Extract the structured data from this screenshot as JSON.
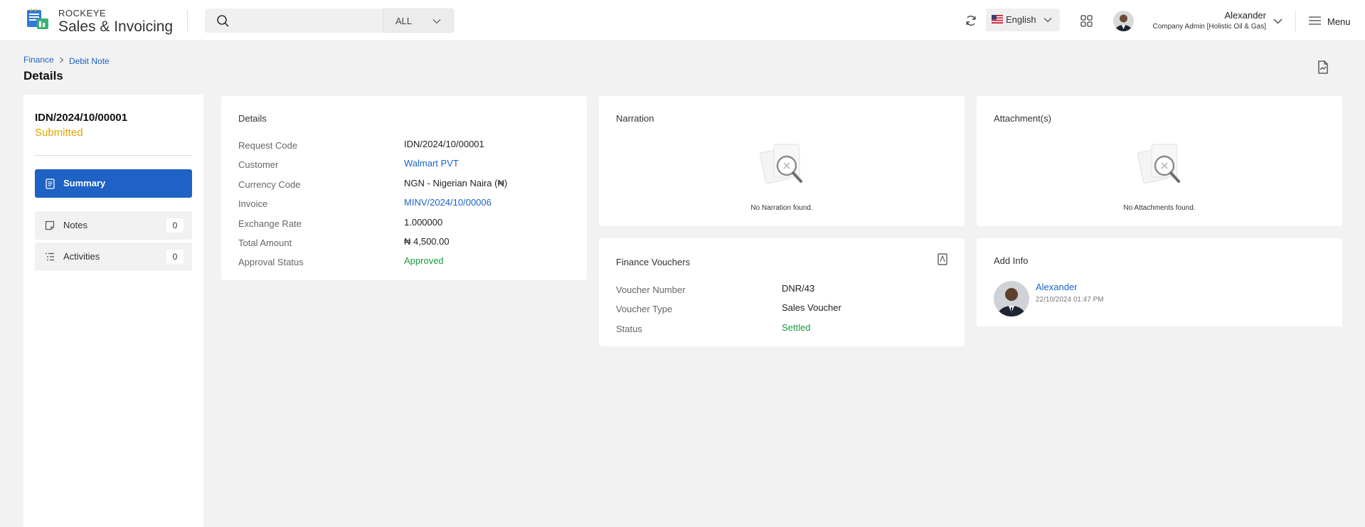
{
  "header": {
    "brand_top": "ROCKEYE",
    "brand_main": "Sales & Invoicing",
    "search_placeholder": "",
    "scope_label": "ALL",
    "language": "English",
    "user_name": "Alexander",
    "user_role": "Company Admin [Holistic Oil & Gas]",
    "menu_label": "Menu"
  },
  "breadcrumb": [
    "Finance",
    "Debit Note"
  ],
  "page_title": "Details",
  "sidebar": {
    "code": "IDN/2024/10/00001",
    "status": "Submitted",
    "status_color": "#e0a400",
    "nav": [
      {
        "label": "Summary",
        "active": true
      },
      {
        "label": "Notes",
        "count": "0"
      },
      {
        "label": "Activities",
        "count": "0"
      }
    ]
  },
  "details": {
    "title": "Details",
    "rows": [
      {
        "label": "Request Code",
        "value": "IDN/2024/10/00001"
      },
      {
        "label": "Customer",
        "value": "Walmart PVT"
      },
      {
        "label": "Currency Code",
        "value": "NGN - Nigerian Naira (₦)"
      },
      {
        "label": "Invoice",
        "value": "MINV/2024/10/00006"
      },
      {
        "label": "Exchange Rate",
        "value": "1.000000"
      },
      {
        "label": "Total Amount",
        "value": "₦ 4,500.00"
      },
      {
        "label": "Approval Status",
        "value": "Approved"
      }
    ]
  },
  "narration": {
    "title": "Narration",
    "empty": "No Narration found."
  },
  "attachments": {
    "title": "Attachment(s)",
    "empty": "No Attachments found."
  },
  "vouchers": {
    "title": "Finance Vouchers",
    "rows": [
      {
        "label": "Voucher Number",
        "value": "DNR/43"
      },
      {
        "label": "Voucher Type",
        "value": "Sales Voucher"
      },
      {
        "label": "Status",
        "value": "Settled"
      }
    ]
  },
  "add_info": {
    "title": "Add Info",
    "name": "Alexander",
    "date": "22/10/2024 01:47 PM"
  },
  "colors": {
    "primary": "#1d62c4",
    "link": "#1a63c7",
    "success": "#1a9a3c",
    "warning": "#e0a400"
  }
}
